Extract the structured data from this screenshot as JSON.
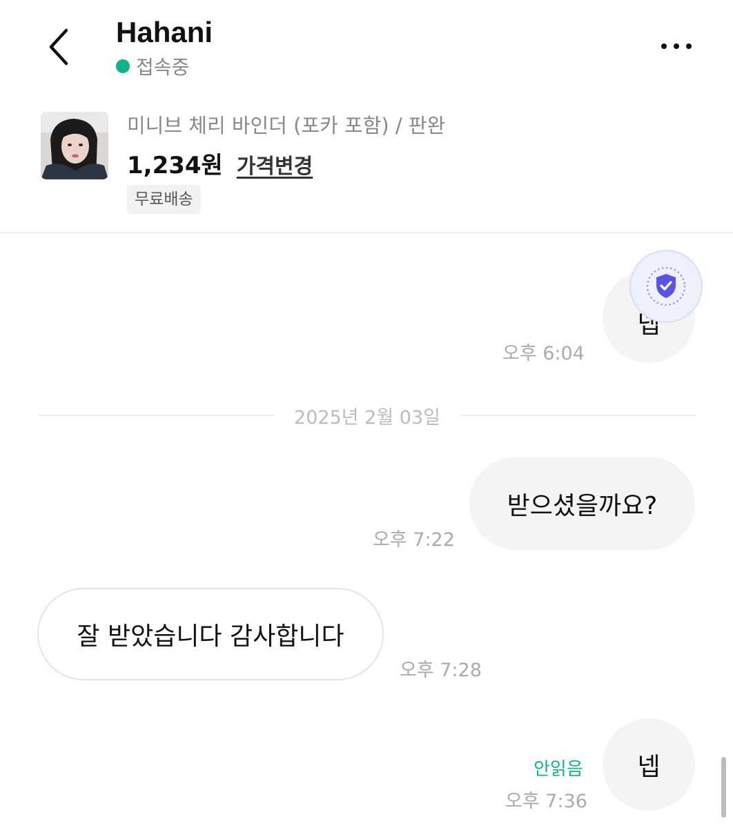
{
  "header": {
    "partner_name": "Hahani",
    "status_text": "접속중"
  },
  "product": {
    "title": "미니브 체리 바인더 (포카 포함) / 판완",
    "price": "1,234원",
    "price_change_label": "가격변경",
    "shipping_tag": "무료배송"
  },
  "chat": {
    "messages": [
      {
        "sender": "me",
        "text": "넵",
        "time": "오후 6:04"
      },
      {
        "sender": "me",
        "text": "받으셨을까요?",
        "time": "오후 7:22"
      },
      {
        "sender": "partner",
        "text": "잘 받았습니다 감사합니다",
        "time": "오후 7:28"
      },
      {
        "sender": "me",
        "text": "넵",
        "time": "오후 7:36",
        "status": "안읽음"
      }
    ],
    "date_separator": "2025년 2월 03일"
  },
  "colors": {
    "online": "#10b38a",
    "unread": "#10b38a",
    "my_bubble": "#f4f4f4",
    "badge_shield": "#5b50e8"
  },
  "icons": {
    "back": "chevron-left-icon",
    "more": "more-horizontal-icon",
    "safe": "shield-check-icon"
  }
}
